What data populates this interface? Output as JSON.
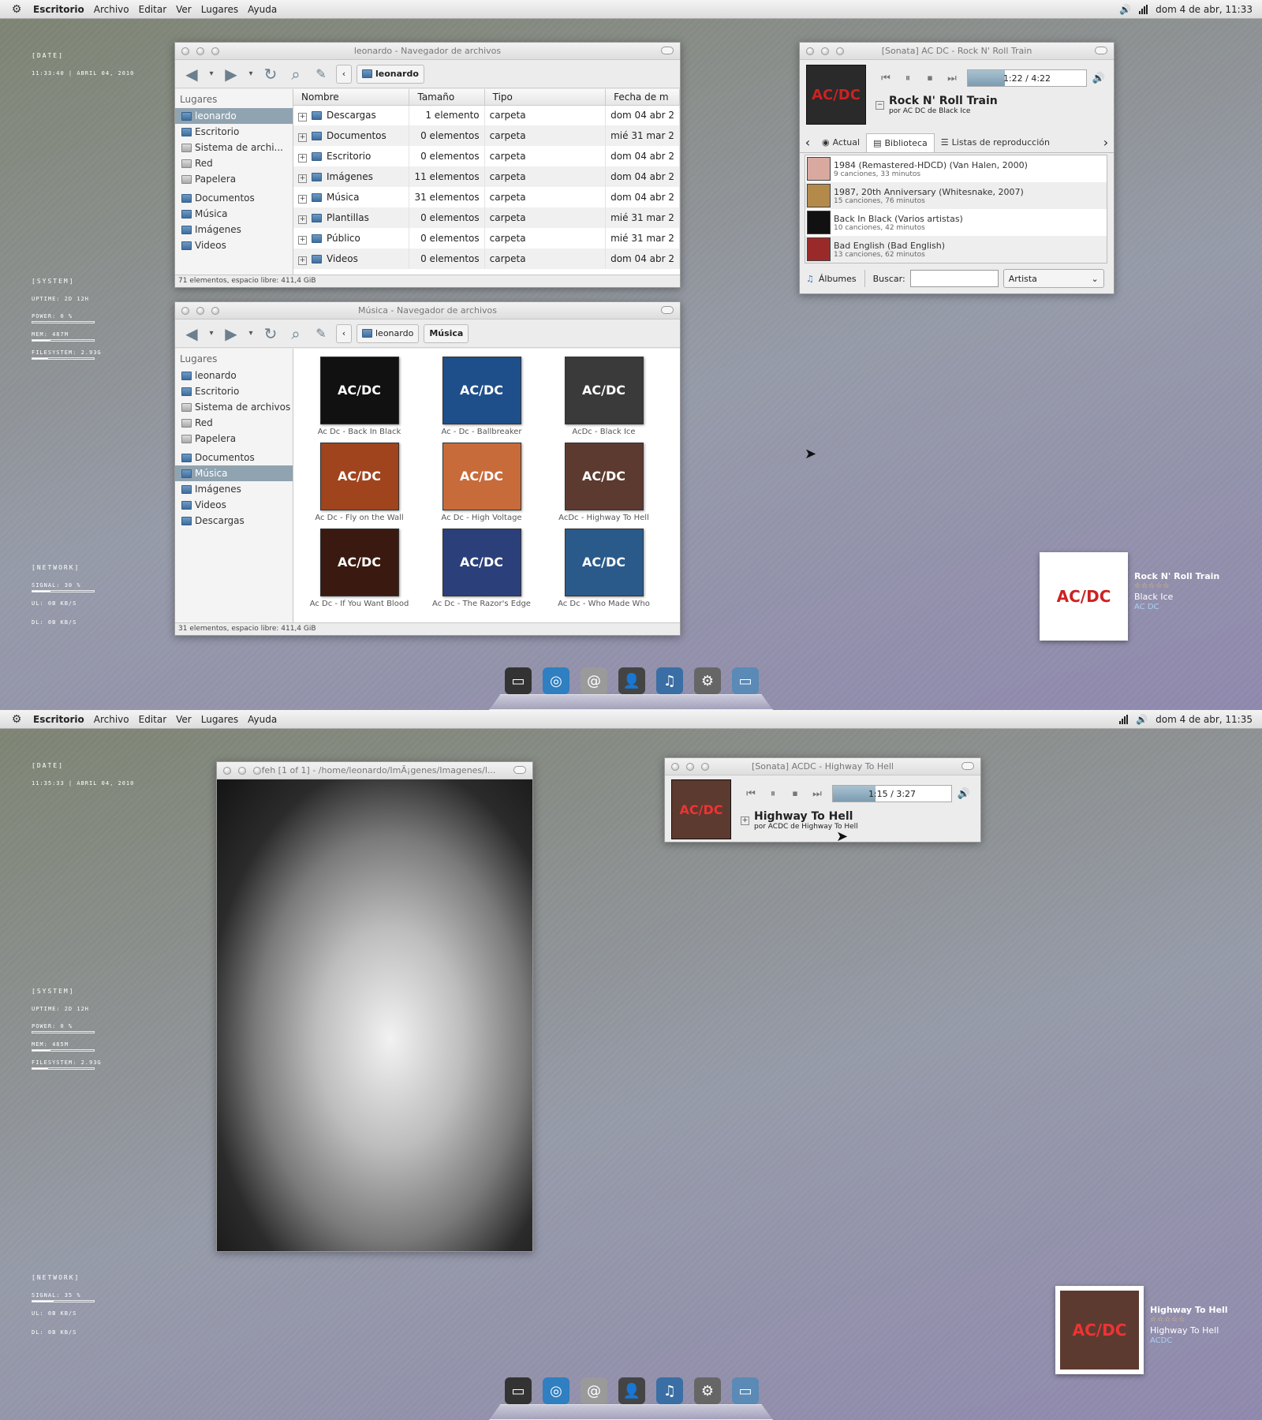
{
  "screens": [
    {
      "topbar": {
        "menus": [
          "Escritorio",
          "Archivo",
          "Editar",
          "Ver",
          "Lugares",
          "Ayuda"
        ],
        "datetime": "dom  4 de abr, 11:33"
      },
      "conky": {
        "date_title": "[DATE]",
        "date_value": "11:33:40 | ABRIL 04, 2010",
        "system_title": "[SYSTEM]",
        "uptime": "UPTIME: 2D 12H",
        "power_label": "POWER: 0 %",
        "power_level": 0.0,
        "mem_label": "MEM: 487M",
        "mem_level": 0.3,
        "fs_label": "FILESYSTEM: 2.93G",
        "fs_level": 0.25,
        "network_title": "[NETWORK]",
        "signal_label": "SIGNAL: 30  %",
        "signal_level": 0.3,
        "ul": "UL: 0B     KB/S",
        "dl": "DL: 0B     KB/S"
      }
    },
    {
      "topbar": {
        "menus": [
          "Escritorio",
          "Archivo",
          "Editar",
          "Ver",
          "Lugares",
          "Ayuda"
        ],
        "datetime": "dom  4 de abr, 11:35"
      },
      "conky": {
        "date_title": "[DATE]",
        "date_value": "11:35:33 | ABRIL 04, 2010",
        "system_title": "[SYSTEM]",
        "uptime": "UPTIME: 2D 12H",
        "power_label": "POWER: 0 %",
        "power_level": 0.0,
        "mem_label": "MEM: 485M",
        "mem_level": 0.3,
        "fs_label": "FILESYSTEM: 2.93G",
        "fs_level": 0.25,
        "network_title": "[NETWORK]",
        "signal_label": "SIGNAL: 35  %",
        "signal_level": 0.35,
        "ul": "UL: 0B     KB/S",
        "dl": "DL: 0B     KB/S"
      }
    }
  ],
  "nautilus1": {
    "title": "leonardo - Navegador de archivos",
    "crumb": "leonardo",
    "sidebar_header": "Lugares",
    "places": [
      "leonardo",
      "Escritorio",
      "Sistema de archi...",
      "Red",
      "Papelera"
    ],
    "bookmarks": [
      "Documentos",
      "Música",
      "Imágenes",
      "Videos"
    ],
    "columns": [
      "Nombre",
      "Tamaño",
      "Tipo",
      "Fecha de m"
    ],
    "rows": [
      [
        "Descargas",
        "1 elemento",
        "carpeta",
        "dom 04 abr 2"
      ],
      [
        "Documentos",
        "0 elementos",
        "carpeta",
        "mié 31 mar 2"
      ],
      [
        "Escritorio",
        "0 elementos",
        "carpeta",
        "dom 04 abr 2"
      ],
      [
        "Imágenes",
        "11 elementos",
        "carpeta",
        "dom 04 abr 2"
      ],
      [
        "Música",
        "31 elementos",
        "carpeta",
        "dom 04 abr 2"
      ],
      [
        "Plantillas",
        "0 elementos",
        "carpeta",
        "mié 31 mar 2"
      ],
      [
        "Público",
        "0 elementos",
        "carpeta",
        "mié 31 mar 2"
      ],
      [
        "Videos",
        "0 elementos",
        "carpeta",
        "dom 04 abr 2"
      ]
    ],
    "status": "71 elementos, espacio libre: 411,4 GiB"
  },
  "nautilus2": {
    "title": "Música - Navegador de archivos",
    "crumbs": [
      "leonardo",
      "Música"
    ],
    "sidebar_header": "Lugares",
    "places": [
      "leonardo",
      "Escritorio",
      "Sistema de archivos",
      "Red",
      "Papelera"
    ],
    "bookmarks": [
      "Documentos",
      "Música",
      "Imágenes",
      "Videos",
      "Descargas"
    ],
    "albums": [
      {
        "label": "Ac Dc - Back In Black",
        "art": "AC/DC",
        "color": "#111111"
      },
      {
        "label": "Ac - Dc - Ballbreaker",
        "art": "AC/DC",
        "color": "#1f4f8a"
      },
      {
        "label": "AcDc - Black Ice",
        "art": "AC/DC",
        "color": "#3a3a3a"
      },
      {
        "label": "Ac Dc - Fly on the Wall",
        "art": "AC/DC",
        "color": "#a0441e"
      },
      {
        "label": "Ac Dc - High Voltage",
        "art": "AC/DC",
        "color": "#c86b3a"
      },
      {
        "label": "AcDc - Highway To Hell",
        "art": "AC/DC",
        "color": "#5c3a30"
      },
      {
        "label": "Ac Dc - If You Want Blood",
        "art": "AC/DC",
        "color": "#3a1a10"
      },
      {
        "label": "Ac Dc - The Razor's Edge",
        "art": "AC/DC",
        "color": "#2b3f7a"
      },
      {
        "label": "Ac Dc - Who Made Who",
        "art": "AC/DC",
        "color": "#2a5a8a"
      }
    ],
    "status": "31 elementos, espacio libre: 411,4 GiB"
  },
  "sonata1": {
    "title": "[Sonata] AC DC - Rock N' Roll Train",
    "time": "1:22 / 4:22",
    "progress": 0.31,
    "song": "Rock N' Roll Train",
    "by": "por AC DC de Black Ice",
    "tabs": [
      "Actual",
      "Biblioteca",
      "Listas de reproducción"
    ],
    "library": [
      {
        "a": "1984 (Remastered-HDCD) (Van Halen, 2000)",
        "b": "9 canciones, 33 minutos",
        "color": "#d9a9a0"
      },
      {
        "a": "1987, 20th Anniversary (Whitesnake, 2007)",
        "b": "15 canciones, 76 minutos",
        "color": "#b48a4a"
      },
      {
        "a": "Back In Black (Varios artistas)",
        "b": "10 canciones, 42 minutos",
        "color": "#111111"
      },
      {
        "a": "Bad English (Bad English)",
        "b": "13 canciones, 62 minutos",
        "color": "#9a2a2a"
      }
    ],
    "albums_label": "Álbumes",
    "search_label": "Buscar:",
    "search_value": "",
    "filter": "Artista"
  },
  "sonata2": {
    "title": "[Sonata] ACDC - Highway To Hell",
    "time": "1:15 / 3:27",
    "progress": 0.36,
    "song": "Highway To Hell",
    "by": "por ACDC de Highway To Hell"
  },
  "feh": {
    "title": "feh [1 of 1] - /home/leonardo/ImÃ¡genes/Imagenes/l..."
  },
  "notify1": {
    "title": "Rock N' Roll Train",
    "stars": "☆☆☆☆☆",
    "album": "Black Ice",
    "artist": "AC DC",
    "art": "AC/DC",
    "color": "#2a2a2a"
  },
  "notify2": {
    "title": "Highway To Hell",
    "stars": "☆☆☆☆☆",
    "album": "Highway To Hell",
    "artist": "ACDC",
    "art": "AC/DC",
    "color": "#5c3a30"
  },
  "dock": {
    "icons": [
      "terminal-icon",
      "browser-icon",
      "mail-icon",
      "contacts-icon",
      "music-player-icon",
      "settings-icon",
      "display-icon"
    ]
  }
}
